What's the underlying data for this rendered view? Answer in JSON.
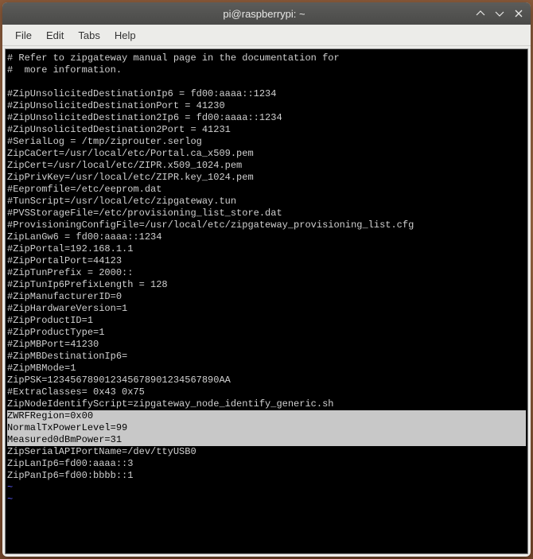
{
  "titlebar": {
    "title": "pi@raspberrypi: ~"
  },
  "menubar": {
    "file": "File",
    "edit": "Edit",
    "tabs": "Tabs",
    "help": "Help"
  },
  "lines": [
    {
      "text": "# Refer to zipgateway manual page in the documentation for",
      "hl": false
    },
    {
      "text": "#  more information.",
      "hl": false
    },
    {
      "text": "",
      "hl": false
    },
    {
      "text": "#ZipUnsolicitedDestinationIp6 = fd00:aaaa::1234",
      "hl": false
    },
    {
      "text": "#ZipUnsolicitedDestinationPort = 41230",
      "hl": false
    },
    {
      "text": "#ZipUnsolicitedDestination2Ip6 = fd00:aaaa::1234",
      "hl": false
    },
    {
      "text": "#ZipUnsolicitedDestination2Port = 41231",
      "hl": false
    },
    {
      "text": "#SerialLog = /tmp/ziprouter.serlog",
      "hl": false
    },
    {
      "text": "ZipCaCert=/usr/local/etc/Portal.ca_x509.pem",
      "hl": false
    },
    {
      "text": "ZipCert=/usr/local/etc/ZIPR.x509_1024.pem",
      "hl": false
    },
    {
      "text": "ZipPrivKey=/usr/local/etc/ZIPR.key_1024.pem",
      "hl": false
    },
    {
      "text": "#Eepromfile=/etc/eeprom.dat",
      "hl": false
    },
    {
      "text": "#TunScript=/usr/local/etc/zipgateway.tun",
      "hl": false
    },
    {
      "text": "#PVSStorageFile=/etc/provisioning_list_store.dat",
      "hl": false
    },
    {
      "text": "#ProvisioningConfigFile=/usr/local/etc/zipgateway_provisioning_list.cfg",
      "hl": false
    },
    {
      "text": "ZipLanGw6 = fd00:aaaa::1234",
      "hl": false
    },
    {
      "text": "#ZipPortal=192.168.1.1",
      "hl": false
    },
    {
      "text": "#ZipPortalPort=44123",
      "hl": false
    },
    {
      "text": "#ZipTunPrefix = 2000::",
      "hl": false
    },
    {
      "text": "#ZipTunIp6PrefixLength = 128",
      "hl": false
    },
    {
      "text": "#ZipManufacturerID=0",
      "hl": false
    },
    {
      "text": "#ZipHardwareVersion=1",
      "hl": false
    },
    {
      "text": "#ZipProductID=1",
      "hl": false
    },
    {
      "text": "#ZipProductType=1",
      "hl": false
    },
    {
      "text": "#ZipMBPort=41230",
      "hl": false
    },
    {
      "text": "#ZipMBDestinationIp6=",
      "hl": false
    },
    {
      "text": "#ZipMBMode=1",
      "hl": false
    },
    {
      "text": "ZipPSK=123456789012345678901234567890AA",
      "hl": false
    },
    {
      "text": "#ExtraClasses= 0x43 0x75",
      "hl": false
    },
    {
      "text": "ZipNodeIdentifyScript=zipgateway_node_identify_generic.sh",
      "hl": false
    },
    {
      "text": "ZWRFRegion=0x00",
      "hl": true
    },
    {
      "text": "NormalTxPowerLevel=99",
      "hl": true
    },
    {
      "text": "Measured0dBmPower=31",
      "hl": true
    },
    {
      "text": "ZipSerialAPIPortName=/dev/ttyUSB0",
      "hl": false
    },
    {
      "text": "ZipLanIp6=fd00:aaaa::3",
      "hl": false
    },
    {
      "text": "ZipPanIp6=fd00:bbbb::1",
      "hl": false
    }
  ],
  "tildes": [
    "~",
    "~"
  ]
}
